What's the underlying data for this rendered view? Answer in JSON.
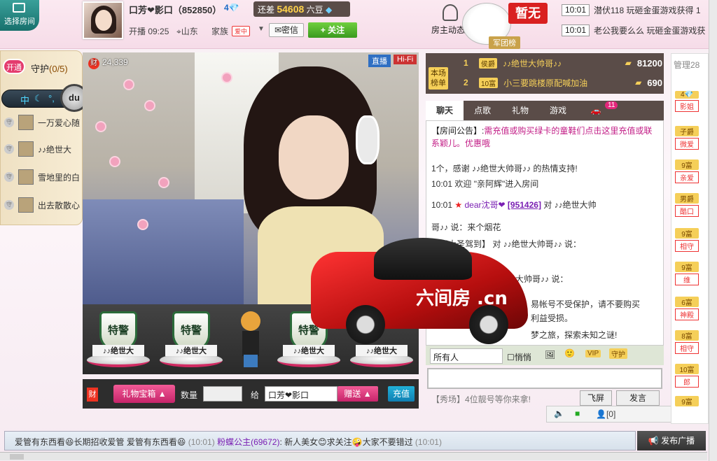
{
  "top": {
    "choose_room": "选择房间",
    "host_name": "口芳❤影口（852850）",
    "host_level": "4💎",
    "gap_label": "还差",
    "gap_value": "54608",
    "gap_unit": "六豆",
    "stream_time": "开播 09:25",
    "location": "山东",
    "family_label": "家族",
    "family_badge": "爱中",
    "family_drop": "▼",
    "msg_label": "✉密信",
    "follow_label": "+ 关注",
    "room_feed": "房主动态",
    "legion": "军团榜",
    "none_badge": "暂无"
  },
  "ticker": [
    {
      "time": "10:01",
      "msg": "潜伏118 玩砸金蛋游戏获得 1"
    },
    {
      "time": "10:01",
      "msg": "老公我要么么 玩砸金蛋游戏获"
    }
  ],
  "guard": {
    "open_label": "开通",
    "title": "守护",
    "count": "(0/5)",
    "items": [
      {
        "flag": "守",
        "name": "一万爱心随"
      },
      {
        "flag": "守",
        "name": "♪♪绝世大"
      },
      {
        "flag": "守",
        "name": "雪地里的白"
      },
      {
        "flag": "守",
        "name": "出去散散心"
      }
    ]
  },
  "toolstrip": {
    "mid": "中",
    "du": "du"
  },
  "video": {
    "wealth_icon": "财",
    "wealth_value": "24,339",
    "live_tag": "直播",
    "hifi_tag": "Hi-Fi"
  },
  "gifts": [
    {
      "label": "特警",
      "caption": "♪♪绝世大"
    },
    {
      "label": "特警",
      "caption": "♪♪绝世大"
    },
    {
      "label": "特警",
      "caption": "♪♪绝世大"
    },
    {
      "label": "",
      "caption": "♪♪绝世大"
    }
  ],
  "controls": {
    "wealth": "财",
    "giftbox": "礼物宝箱 ▲",
    "qty_label": "数量",
    "give_label": "给",
    "target": "口芳❤影口",
    "send": "赠送 ▲",
    "recharge": "充值"
  },
  "rank": {
    "label": "本场榜单",
    "rows": [
      {
        "no": "1",
        "lv": "侯爵",
        "name": "♪♪绝世大帅哥♪♪",
        "score": "81200"
      },
      {
        "no": "2",
        "lv": "10富",
        "name": "小三要跳楼原配喊加油",
        "score": "690"
      }
    ]
  },
  "tabs": [
    {
      "label": "聊天"
    },
    {
      "label": "点歌"
    },
    {
      "label": "礼物"
    },
    {
      "label": "游戏"
    },
    {
      "label": "🚗"
    }
  ],
  "car_badge": "11",
  "chat": {
    "notice_prefix": "【房间公告】:",
    "notice_body": "需充值或购买绿卡的童鞋们点击这里充值或联系颖儿。优惠哦",
    "line1": "1个，感谢 ♪♪绝世大帅哥♪♪ 的热情支持!",
    "line2_time": "10:01",
    "line2": "欢迎 \"亲阿辉\"进入房间",
    "line3_time": "10:01",
    "line3_user": "dear沈哥❤",
    "line3_id": "[951426]",
    "line3_to": "对 ♪♪绝世大帅",
    "line4": "哥♪♪ 说：来个烟花",
    "line5": "齐天大圣驾到】 对 ♪♪绝世大帅哥♪♪ 说：",
    "line6": "♪♪绝世大帅哥♪♪ 说：",
    "line7": "易帐号不受保护，请不要购买",
    "line8": "利益受损。",
    "line9": "梦之旅，探索未知之谜!",
    "car_logo": "六间房 .cn"
  },
  "chat_opts": {
    "to_all": "所有人",
    "private": "悄悄",
    "vip": "VIP",
    "guard": "守护"
  },
  "show_field": "【秀场】4位靓号等你来拿!",
  "fly_btn": "飞屏",
  "say_btn": "发言",
  "mini_bar": "[0]",
  "right_col": {
    "manage": "管理28",
    "items": [
      {
        "lv": "4💎",
        "name": "影姐"
      },
      {
        "lv": "子爵",
        "name": "微爱"
      },
      {
        "lv": "9富",
        "name": "亲爱"
      },
      {
        "lv": "男爵",
        "name": "酷口"
      },
      {
        "lv": "9富",
        "name": "相守"
      },
      {
        "lv": "9富",
        "name": "维"
      },
      {
        "lv": "6富",
        "name": "神殿"
      },
      {
        "lv": "8富",
        "name": "相守"
      },
      {
        "lv": "10富",
        "name": "郎"
      },
      {
        "lv": "9富",
        "name": ""
      }
    ]
  },
  "marquee": {
    "t1": "爱管有东西看😆长期招收爱管 爱管有东西看😆",
    "time1": "(10:01)",
    "user": "粉蝶公主(69672)",
    "t2": ": 新人美女😊求关注🤪大家不要错过",
    "time2": "(10:01)"
  },
  "broadcast": "📢 发布广播"
}
